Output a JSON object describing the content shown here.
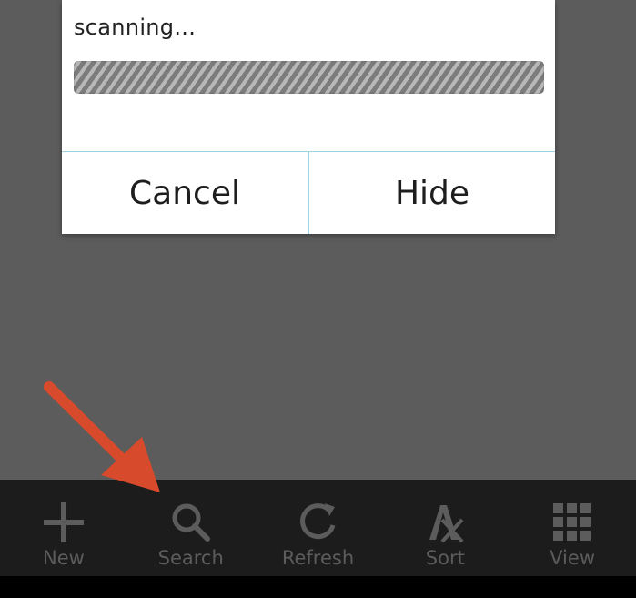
{
  "dialog": {
    "message": "scanning...",
    "buttons": {
      "cancel": "Cancel",
      "hide": "Hide"
    }
  },
  "toolbar": {
    "items": [
      {
        "label": "New",
        "icon": "plus-icon"
      },
      {
        "label": "Search",
        "icon": "search-icon"
      },
      {
        "label": "Refresh",
        "icon": "refresh-icon"
      },
      {
        "label": "Sort",
        "icon": "sort-alpha-icon"
      },
      {
        "label": "View",
        "icon": "grid-icon"
      }
    ]
  },
  "colors": {
    "background": "#5c5c5c",
    "dialog_divider": "#9fd3e4",
    "toolbar_background": "#1c1c1c",
    "toolbar_icon": "#5c5c5c",
    "annotation_arrow": "#d84a2c"
  }
}
